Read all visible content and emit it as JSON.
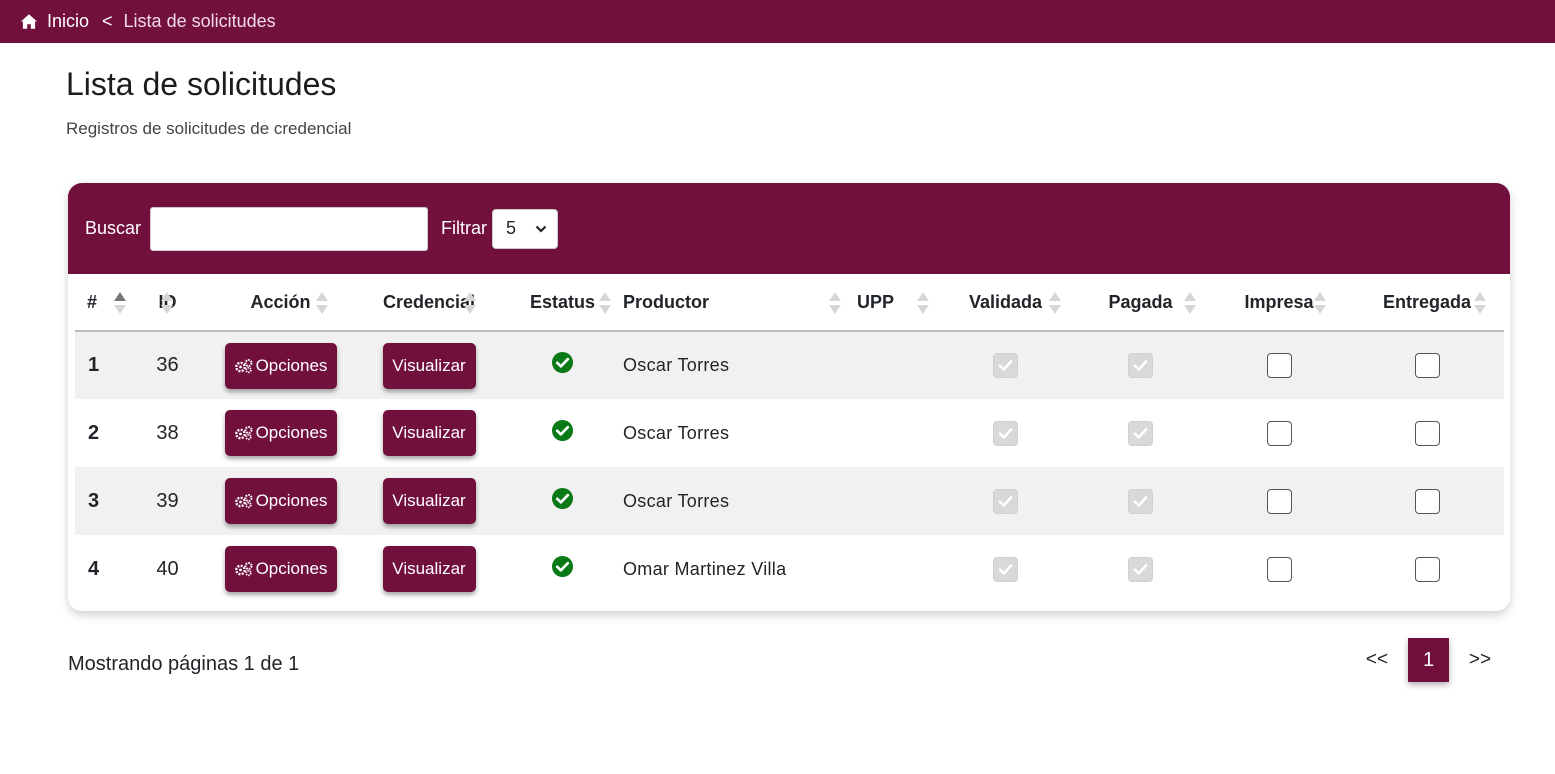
{
  "breadcrumb": {
    "home": "Inicio",
    "separator": "<",
    "current": "Lista de solicitudes"
  },
  "page": {
    "title": "Lista de solicitudes",
    "subtitle": "Registros de solicitudes de credencial"
  },
  "toolbar": {
    "search_label": "Buscar",
    "search_value": "",
    "filter_label": "Filtrar",
    "filter_value": "5"
  },
  "table": {
    "columns": [
      "#",
      "ID",
      "Acción",
      "Credencial",
      "Estatus",
      "Productor",
      "UPP",
      "Validada",
      "Pagada",
      "Impresa",
      "Entregada"
    ],
    "rows": [
      {
        "num": "1",
        "id": "36",
        "action": "Opciones",
        "credential": "Visualizar",
        "status": "check-circle-icon",
        "producer": "Oscar Torres",
        "upp": "",
        "validated": true,
        "paid": true,
        "printed": false,
        "delivered": false
      },
      {
        "num": "2",
        "id": "38",
        "action": "Opciones",
        "credential": "Visualizar",
        "status": "check-circle-icon",
        "producer": "Oscar Torres",
        "upp": "",
        "validated": true,
        "paid": true,
        "printed": false,
        "delivered": false
      },
      {
        "num": "3",
        "id": "39",
        "action": "Opciones",
        "credential": "Visualizar",
        "status": "check-circle-icon",
        "producer": "Oscar Torres",
        "upp": "",
        "validated": true,
        "paid": true,
        "printed": false,
        "delivered": false
      },
      {
        "num": "4",
        "id": "40",
        "action": "Opciones",
        "credential": "Visualizar",
        "status": "check-circle-icon",
        "producer": "Omar Martinez Villa",
        "upp": "",
        "validated": true,
        "paid": true,
        "printed": false,
        "delivered": false
      }
    ]
  },
  "pagination": {
    "summary": "Mostrando páginas 1 de 1",
    "prev": "<<",
    "current": "1",
    "next": ">>"
  },
  "colors": {
    "brand": "#72103d",
    "status_ok": "#0a7a17"
  }
}
